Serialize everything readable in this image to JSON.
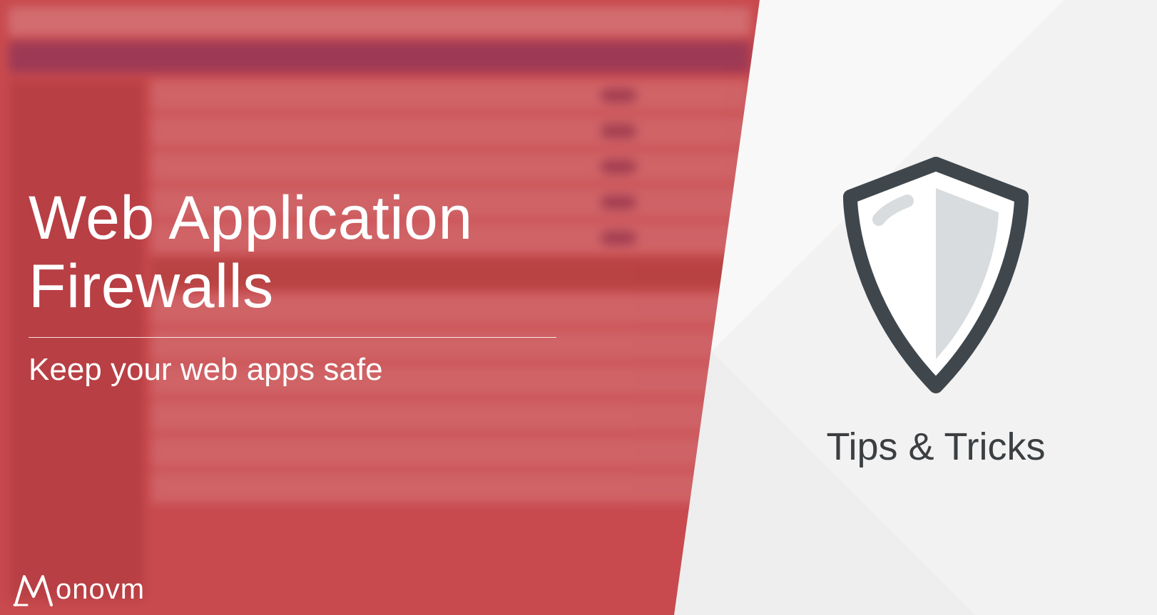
{
  "headline": {
    "title_line1": "Web Application",
    "title_line2": "Firewalls",
    "subtitle": "Keep your web apps safe"
  },
  "right": {
    "label": "Tips & Tricks"
  },
  "brand": {
    "name": "onovm"
  },
  "colors": {
    "red_overlay": "#c84a4e",
    "shield_stroke": "#3f474d",
    "text_dark": "#3b3f42"
  }
}
